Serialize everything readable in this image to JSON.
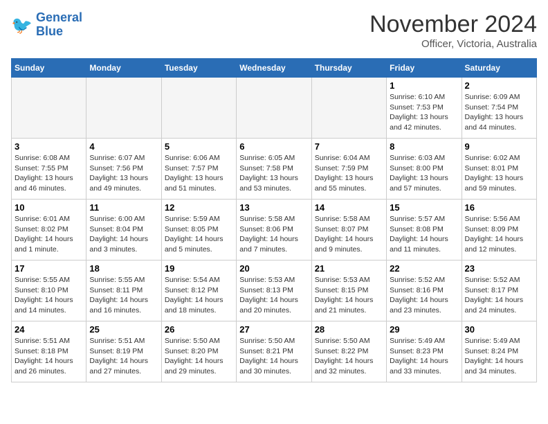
{
  "header": {
    "logo_line1": "General",
    "logo_line2": "Blue",
    "month": "November 2024",
    "location": "Officer, Victoria, Australia"
  },
  "weekdays": [
    "Sunday",
    "Monday",
    "Tuesday",
    "Wednesday",
    "Thursday",
    "Friday",
    "Saturday"
  ],
  "weeks": [
    [
      {
        "day": "",
        "info": ""
      },
      {
        "day": "",
        "info": ""
      },
      {
        "day": "",
        "info": ""
      },
      {
        "day": "",
        "info": ""
      },
      {
        "day": "",
        "info": ""
      },
      {
        "day": "1",
        "info": "Sunrise: 6:10 AM\nSunset: 7:53 PM\nDaylight: 13 hours\nand 42 minutes."
      },
      {
        "day": "2",
        "info": "Sunrise: 6:09 AM\nSunset: 7:54 PM\nDaylight: 13 hours\nand 44 minutes."
      }
    ],
    [
      {
        "day": "3",
        "info": "Sunrise: 6:08 AM\nSunset: 7:55 PM\nDaylight: 13 hours\nand 46 minutes."
      },
      {
        "day": "4",
        "info": "Sunrise: 6:07 AM\nSunset: 7:56 PM\nDaylight: 13 hours\nand 49 minutes."
      },
      {
        "day": "5",
        "info": "Sunrise: 6:06 AM\nSunset: 7:57 PM\nDaylight: 13 hours\nand 51 minutes."
      },
      {
        "day": "6",
        "info": "Sunrise: 6:05 AM\nSunset: 7:58 PM\nDaylight: 13 hours\nand 53 minutes."
      },
      {
        "day": "7",
        "info": "Sunrise: 6:04 AM\nSunset: 7:59 PM\nDaylight: 13 hours\nand 55 minutes."
      },
      {
        "day": "8",
        "info": "Sunrise: 6:03 AM\nSunset: 8:00 PM\nDaylight: 13 hours\nand 57 minutes."
      },
      {
        "day": "9",
        "info": "Sunrise: 6:02 AM\nSunset: 8:01 PM\nDaylight: 13 hours\nand 59 minutes."
      }
    ],
    [
      {
        "day": "10",
        "info": "Sunrise: 6:01 AM\nSunset: 8:02 PM\nDaylight: 14 hours\nand 1 minute."
      },
      {
        "day": "11",
        "info": "Sunrise: 6:00 AM\nSunset: 8:04 PM\nDaylight: 14 hours\nand 3 minutes."
      },
      {
        "day": "12",
        "info": "Sunrise: 5:59 AM\nSunset: 8:05 PM\nDaylight: 14 hours\nand 5 minutes."
      },
      {
        "day": "13",
        "info": "Sunrise: 5:58 AM\nSunset: 8:06 PM\nDaylight: 14 hours\nand 7 minutes."
      },
      {
        "day": "14",
        "info": "Sunrise: 5:58 AM\nSunset: 8:07 PM\nDaylight: 14 hours\nand 9 minutes."
      },
      {
        "day": "15",
        "info": "Sunrise: 5:57 AM\nSunset: 8:08 PM\nDaylight: 14 hours\nand 11 minutes."
      },
      {
        "day": "16",
        "info": "Sunrise: 5:56 AM\nSunset: 8:09 PM\nDaylight: 14 hours\nand 12 minutes."
      }
    ],
    [
      {
        "day": "17",
        "info": "Sunrise: 5:55 AM\nSunset: 8:10 PM\nDaylight: 14 hours\nand 14 minutes."
      },
      {
        "day": "18",
        "info": "Sunrise: 5:55 AM\nSunset: 8:11 PM\nDaylight: 14 hours\nand 16 minutes."
      },
      {
        "day": "19",
        "info": "Sunrise: 5:54 AM\nSunset: 8:12 PM\nDaylight: 14 hours\nand 18 minutes."
      },
      {
        "day": "20",
        "info": "Sunrise: 5:53 AM\nSunset: 8:13 PM\nDaylight: 14 hours\nand 20 minutes."
      },
      {
        "day": "21",
        "info": "Sunrise: 5:53 AM\nSunset: 8:15 PM\nDaylight: 14 hours\nand 21 minutes."
      },
      {
        "day": "22",
        "info": "Sunrise: 5:52 AM\nSunset: 8:16 PM\nDaylight: 14 hours\nand 23 minutes."
      },
      {
        "day": "23",
        "info": "Sunrise: 5:52 AM\nSunset: 8:17 PM\nDaylight: 14 hours\nand 24 minutes."
      }
    ],
    [
      {
        "day": "24",
        "info": "Sunrise: 5:51 AM\nSunset: 8:18 PM\nDaylight: 14 hours\nand 26 minutes."
      },
      {
        "day": "25",
        "info": "Sunrise: 5:51 AM\nSunset: 8:19 PM\nDaylight: 14 hours\nand 27 minutes."
      },
      {
        "day": "26",
        "info": "Sunrise: 5:50 AM\nSunset: 8:20 PM\nDaylight: 14 hours\nand 29 minutes."
      },
      {
        "day": "27",
        "info": "Sunrise: 5:50 AM\nSunset: 8:21 PM\nDaylight: 14 hours\nand 30 minutes."
      },
      {
        "day": "28",
        "info": "Sunrise: 5:50 AM\nSunset: 8:22 PM\nDaylight: 14 hours\nand 32 minutes."
      },
      {
        "day": "29",
        "info": "Sunrise: 5:49 AM\nSunset: 8:23 PM\nDaylight: 14 hours\nand 33 minutes."
      },
      {
        "day": "30",
        "info": "Sunrise: 5:49 AM\nSunset: 8:24 PM\nDaylight: 14 hours\nand 34 minutes."
      }
    ]
  ]
}
